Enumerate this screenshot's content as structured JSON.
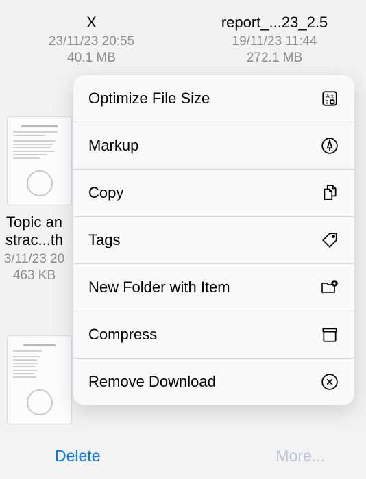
{
  "files": [
    {
      "name": "X",
      "date": "23/11/23 20:55",
      "size": "40.1 MB"
    },
    {
      "name": "report_...23_2.5",
      "date": "19/11/23 11:44",
      "size": "272.1 MB"
    }
  ],
  "file2": {
    "name_line1": "Topic an",
    "name_line2": "strac...th",
    "date": "3/11/23 20",
    "size": "463 KB"
  },
  "menu": {
    "optimize": "Optimize File Size",
    "markup": "Markup",
    "copy": "Copy",
    "tags": "Tags",
    "new_folder": "New Folder with Item",
    "compress": "Compress",
    "remove_download": "Remove Download"
  },
  "bottom": {
    "delete": "Delete",
    "more": "More..."
  }
}
